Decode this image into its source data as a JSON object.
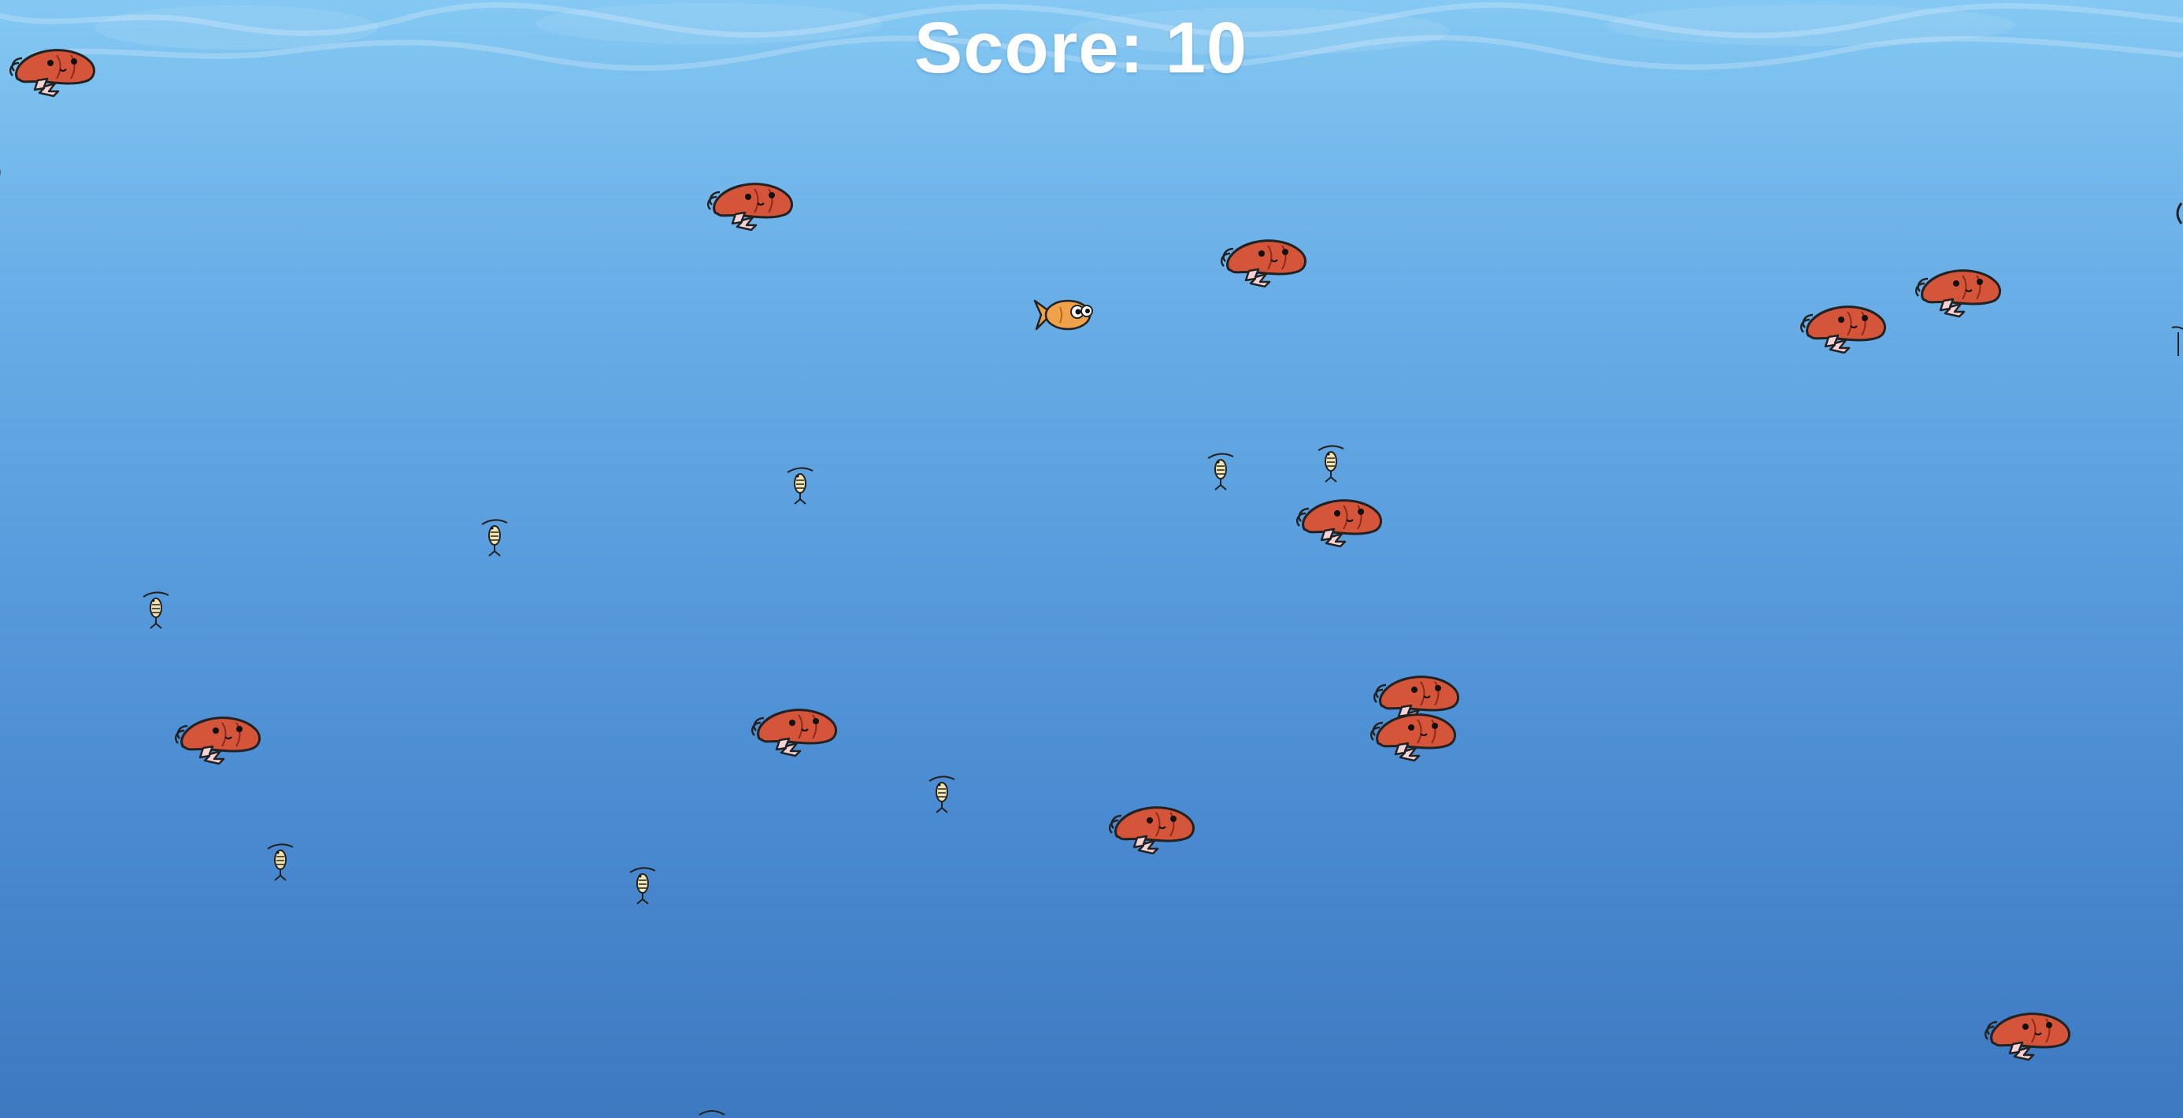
{
  "game": {
    "score_label": "Score: 10",
    "score_value": 10
  },
  "colors": {
    "water_top": "#84c8f3",
    "water_bottom": "#3d79c0",
    "shrimp_body": "#d5553b",
    "shrimp_legs": "#f4d2d6",
    "krill_body": "#f2e4b0",
    "fish_body": "#f0a24a",
    "score_text": "#ffffff"
  },
  "icons": {
    "player": "orange-fish-icon",
    "large_food": "shrimp-icon",
    "small_food": "krill-icon"
  }
}
